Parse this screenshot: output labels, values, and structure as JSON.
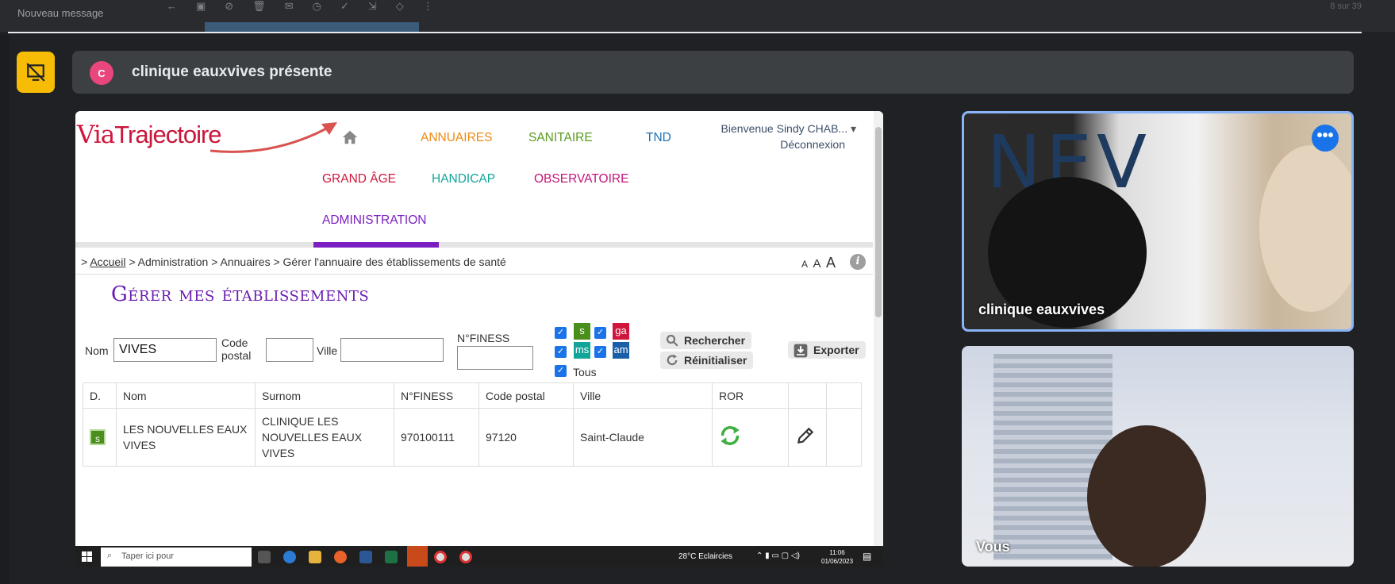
{
  "gmail": {
    "new_message": "Nouveau message",
    "count": "8 sur 39"
  },
  "meet": {
    "presenter_initial": "C",
    "presenting_text": "clinique eauxvives présente",
    "tiles": [
      {
        "name": "clinique eauxvives",
        "logo_text": "NEV"
      },
      {
        "name": "Vous"
      }
    ],
    "accent": "#8ab4f8"
  },
  "app": {
    "logo_via": "Via",
    "logo_traj": "Trajectoire",
    "nav": {
      "annuaires": "ANNUAIRES",
      "sanitaire": "SANITAIRE",
      "tnd": "TND",
      "grand_age": "GRAND ÂGE",
      "handicap": "HANDICAP",
      "observatoire": "OBSERVATOIRE",
      "administration": "ADMINISTRATION"
    },
    "welcome": "Bienvenue Sindy CHAB...",
    "logout": "Déconnexion",
    "breadcrumb": {
      "prefix": ">",
      "home": "Accueil",
      "rest": "> Administration > Annuaires > Gérer l'annuaire des établissements de santé"
    },
    "font_sizes": [
      "A",
      "A",
      "A"
    ],
    "info": "i",
    "page_title": "Gérer mes établissements",
    "form": {
      "nom_label": "Nom",
      "nom_value": "VIVES",
      "cp_label_1": "Code",
      "cp_label_2": "postal",
      "ville_label": "Ville",
      "finess_label": "N°FINESS",
      "domains": [
        "s",
        "ga",
        "ms",
        "am"
      ],
      "tous": "Tous",
      "search_btn": "Rechercher",
      "reset_btn": "Réinitialiser",
      "export_btn": "Exporter"
    },
    "table": {
      "headers": [
        "D.",
        "Nom",
        "Surnom",
        "N°FINESS",
        "Code postal",
        "Ville",
        "ROR",
        "",
        ""
      ],
      "rows": [
        {
          "d": "s",
          "nom": "LES NOUVELLES EAUX VIVES",
          "surnom": "CLINIQUE LES NOUVELLES EAUX VIVES",
          "finess": "970100111",
          "cp": "97120",
          "ville": "Saint-Claude"
        }
      ]
    }
  },
  "taskbar": {
    "search": "Taper ici pour",
    "weather": "28°C  Eclaircies",
    "time": "11:06",
    "date": "01/06/2023"
  }
}
